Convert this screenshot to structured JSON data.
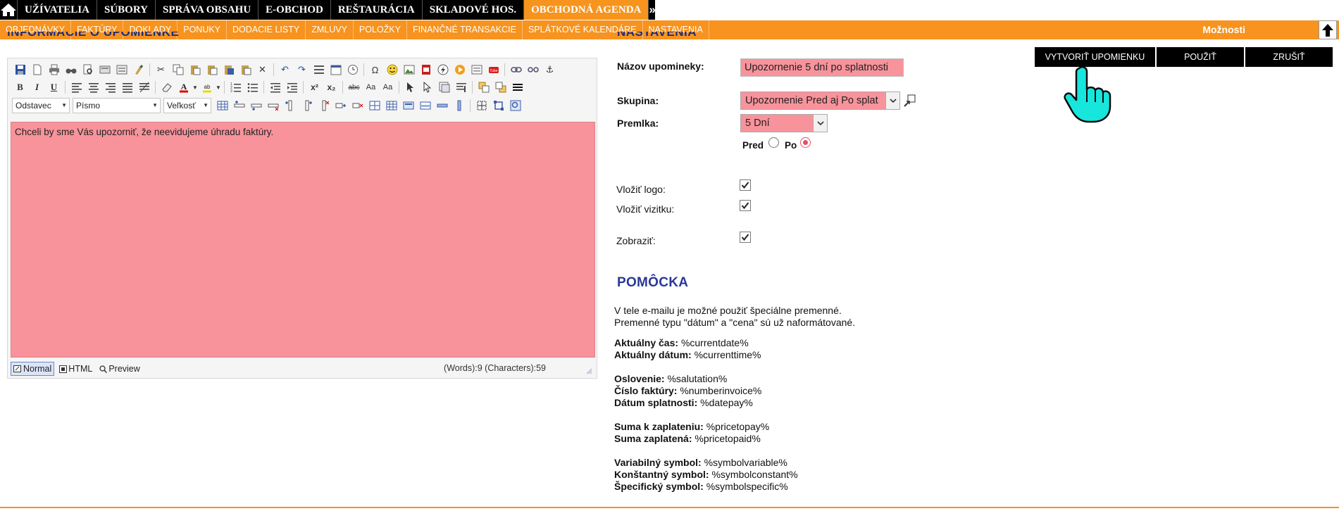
{
  "colors": {
    "accent": "#f7931e",
    "top_menu_bg": "#000000",
    "field_highlight": "#f8939b",
    "help_title": "#2a3797"
  },
  "top_menu": {
    "home_icon": "home-icon",
    "items": [
      "UŽÍVATELIA",
      "SÚBORY",
      "SPRÁVA OBSAHU",
      "E-OBCHOD",
      "REŠTAURÁCIA",
      "SKLADOVÉ HOS.",
      "OBCHODNÁ AGENDA"
    ],
    "active": "OBCHODNÁ AGENDA",
    "more": "»"
  },
  "sub_menu": {
    "items": [
      "OBJEDNÁVKY",
      "FAKTÚRY",
      "DOKLADY",
      "PONUKY",
      "DODACIE LISTY",
      "ZMLUVY",
      "POLOŽKY",
      "FINANČNÉ TRANSAKCIE",
      "SPLÁTKOVÉ KALENDÁRE",
      "NASTAVENIA"
    ],
    "options": "Možnosti",
    "scroll_top_icon": "arrow-up-icon"
  },
  "editor": {
    "section_title": "INFORMÁCIE O UPOMIENKE",
    "format_select": "Odstavec",
    "font_select": "Písmo",
    "size_select": "Veľkosť",
    "content": "Chceli by sme Vás upozorniť, že neevidujeme úhradu faktúry.",
    "modes": [
      "Normal",
      "HTML",
      "Preview"
    ],
    "active_mode": "Normal",
    "counter": "(Words):9 (Characters):59"
  },
  "settings": {
    "section_title": "NASTAVENIA",
    "name_label": "Názov upomineky:",
    "name_value": "Upozornenie 5 dní po splatnosti",
    "group_label": "Skupina:",
    "group_value": "Upozornenie Pred aj Po splat",
    "delay_label": "Premlka:",
    "delay_value": "5 Dní",
    "before_label": "Pred",
    "after_label": "Po",
    "selected_timing": "Po",
    "insert_logo_label": "Vložiť logo:",
    "insert_logo_checked": true,
    "insert_card_label": "Vložiť vizitku:",
    "insert_card_checked": true,
    "show_label": "Zobraziť:",
    "show_checked": true
  },
  "actions": {
    "create": "VYTVORIŤ UPOMIENKU",
    "apply": "POUŽIŤ",
    "cancel": "ZRUŠIŤ"
  },
  "help": {
    "title": "POMÔCKA",
    "intro_1": "V tele e-mailu je možné použiť špeciálne premenné.",
    "intro_2": "Premenné typu \"dátum\" a \"cena\" sú už naformátované.",
    "vars": [
      {
        "label": "Aktuálny čas:",
        "value": "%currentdate%"
      },
      {
        "label": "Aktuálny dátum:",
        "value": "%currenttime%"
      },
      {
        "label": "Oslovenie:",
        "value": "%salutation%"
      },
      {
        "label": "Číslo faktúry:",
        "value": "%numberinvoice%"
      },
      {
        "label": "Dátum splatnosti:",
        "value": "%datepay%"
      },
      {
        "label": "Suma k zaplateniu:",
        "value": "%pricetopay%"
      },
      {
        "label": "Suma zaplatená:",
        "value": "%pricetopaid%"
      },
      {
        "label": "Variabilný symbol:",
        "value": "%symbolvariable%"
      },
      {
        "label": "Konštantný symbol:",
        "value": "%symbolconstant%"
      },
      {
        "label": "Špecifický symbol:",
        "value": "%symbolspecific%"
      }
    ]
  }
}
